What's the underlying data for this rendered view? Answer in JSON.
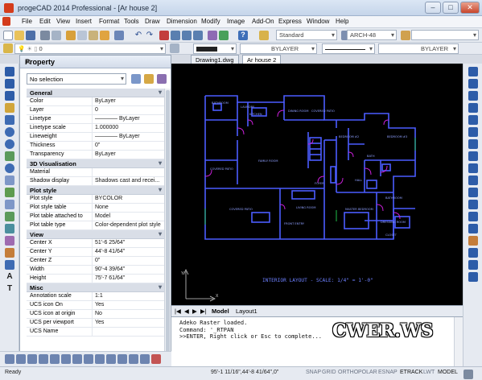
{
  "window": {
    "title": "progeCAD 2014 Professional - [Ar house 2]",
    "min": "–",
    "max": "□",
    "close": "✕"
  },
  "menu": [
    "File",
    "Edit",
    "View",
    "Insert",
    "Format",
    "Tools",
    "Draw",
    "Dimension",
    "Modify",
    "Image",
    "Add-On",
    "Express",
    "Window",
    "Help"
  ],
  "toolbar": {
    "text_style": "Standard",
    "dim_style": "ARCH-48",
    "layer": "0",
    "color": "BYLAYER",
    "linetype": "BYLAYER",
    "lineweight": "BYLAYER"
  },
  "property_panel": {
    "title": "Property",
    "close": "✕",
    "selection": "No selection",
    "sections": [
      {
        "name": "General",
        "rows": [
          [
            "Color",
            "ByLayer"
          ],
          [
            "Layer",
            "0"
          ],
          [
            "Linetype",
            "———— ByLayer"
          ],
          [
            "Linetype scale",
            "1.000000"
          ],
          [
            "Lineweight",
            "———— ByLayer"
          ],
          [
            "Thickness",
            "0\""
          ],
          [
            "Transparency",
            "ByLayer"
          ]
        ]
      },
      {
        "name": "3D Visualisation",
        "rows": [
          [
            "Material",
            ""
          ],
          [
            "Shadow display",
            "Shadows cast and recei..."
          ]
        ]
      },
      {
        "name": "Plot style",
        "rows": [
          [
            "Plot style",
            "BYCOLOR"
          ],
          [
            "Plot style table",
            "None"
          ],
          [
            "Plot table attached to",
            "Model"
          ],
          [
            "Plot table type",
            "Color-dependent plot style"
          ]
        ]
      },
      {
        "name": "View",
        "rows": [
          [
            "Center X",
            "51'-6 25/64\""
          ],
          [
            "Center Y",
            "44'-8 41/64\""
          ],
          [
            "Center Z",
            "0\""
          ],
          [
            "Width",
            "90'-4 39/64\""
          ],
          [
            "Height",
            "75'-7 61/64\""
          ]
        ]
      },
      {
        "name": "Misc",
        "rows": [
          [
            "Annotation scale",
            "1:1"
          ],
          [
            "UCS icon On",
            "Yes"
          ],
          [
            "UCS icon at origin",
            "No"
          ],
          [
            "UCS per viewport",
            "Yes"
          ],
          [
            "UCS Name",
            ""
          ]
        ]
      }
    ]
  },
  "doc_tabs": [
    "Drawing1.dwg",
    "Ar house 2"
  ],
  "layout_tabs": [
    "Model",
    "Layout1"
  ],
  "drawing": {
    "rooms": [
      "BATHROOM",
      "LAUNDRY",
      "KITCHEN",
      "DINING ROOM",
      "COVERED PATIO",
      "FAMILY ROOM",
      "COVERED PATIO",
      "COVERED PATIO",
      "LIVING ROOM",
      "MASTER BEDROOM",
      "BEDROOM #2",
      "BEDROOM #3",
      "BATHROOM",
      "DRESSING ROOM",
      "CLOSET",
      "FOYER",
      "HALL",
      "BATH",
      "FRONT ENTRY"
    ],
    "caption": "INTERIOR LAYOUT - SCALE: 1/4\" = 1'-0\""
  },
  "command_lines": [
    "Adeko Raster loaded.",
    "Command: '_RTPAN",
    ">>ENTER, Right click or Esc to complete..."
  ],
  "watermark": "CWER.WS",
  "status": {
    "ready": "Ready",
    "coords": "95'-1 11/16\",44'-8 41/64\",0\"",
    "toggles": [
      {
        "label": "SNAP",
        "on": false
      },
      {
        "label": "GRID",
        "on": false
      },
      {
        "label": "ORTHO",
        "on": false
      },
      {
        "label": "POLAR",
        "on": false
      },
      {
        "label": "ESNAP",
        "on": false
      },
      {
        "label": "ETRACK",
        "on": true
      },
      {
        "label": "LWT",
        "on": false
      },
      {
        "label": "MODEL",
        "on": true
      }
    ]
  },
  "colors": {
    "floorplan": "#4b5cff",
    "accent": "#c81ed8",
    "door": "#1fbf4a",
    "background": "#000000"
  }
}
